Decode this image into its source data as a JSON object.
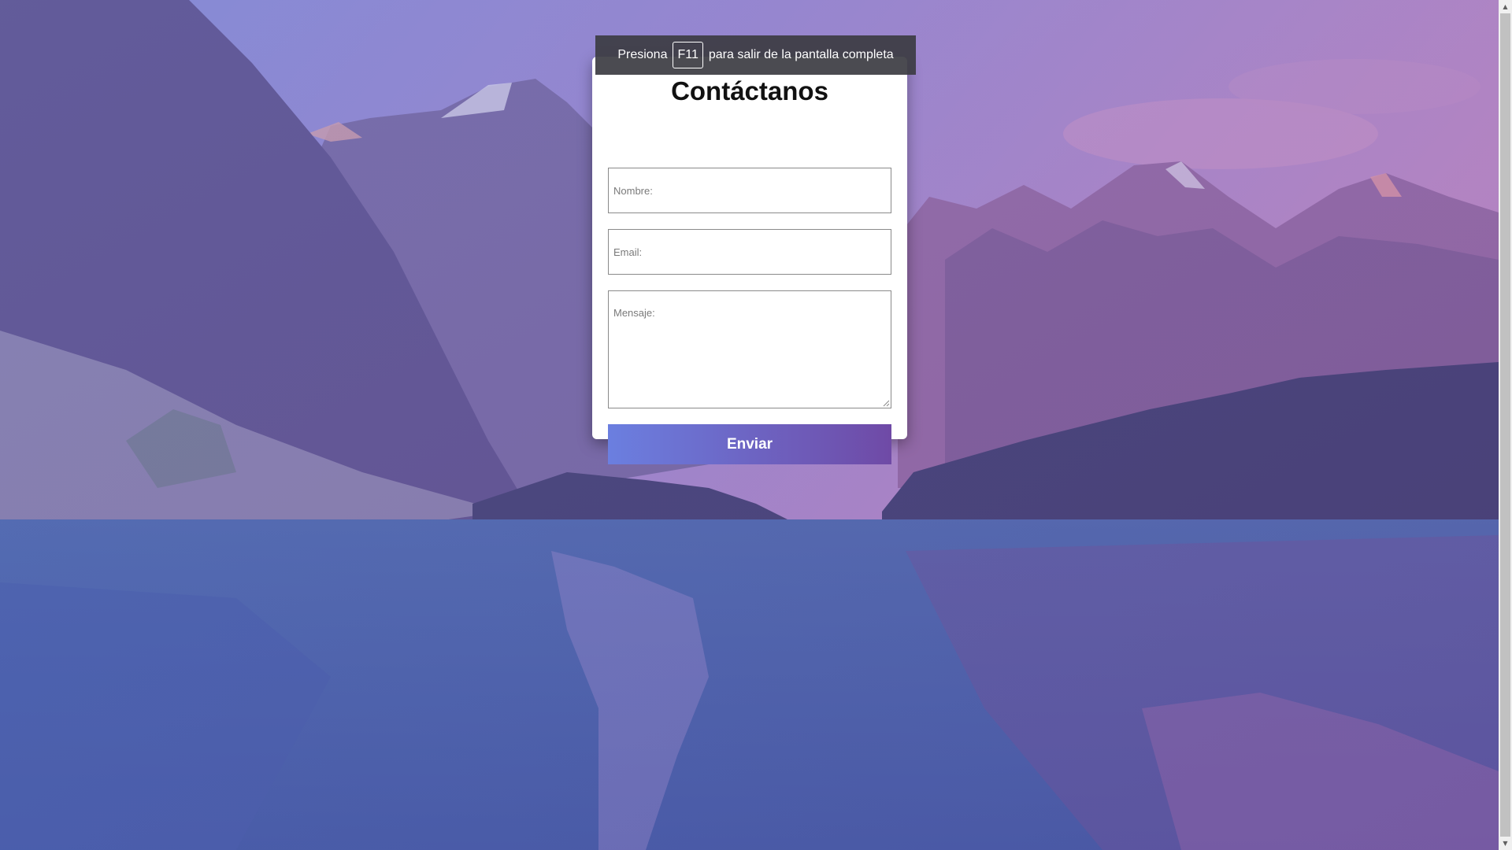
{
  "form": {
    "title": "Contáctanos",
    "name_placeholder": "Nombre:",
    "email_placeholder": "Email:",
    "message_placeholder": "Mensaje:",
    "submit_label": "Enviar"
  },
  "fullscreen_notice": {
    "prefix": "Presiona",
    "key": "F11",
    "suffix": "para salir de la pantalla completa"
  },
  "colors": {
    "button_gradient_start": "#6b7fe0",
    "button_gradient_end": "#6f4aa6",
    "background_overlay": "#6a5fb0"
  }
}
